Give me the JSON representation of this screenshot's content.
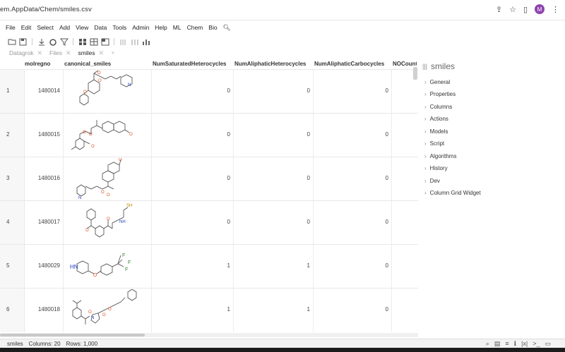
{
  "browser": {
    "url": "em.AppData/Chem/smiles.csv",
    "avatar_letter": "M"
  },
  "menu": [
    "File",
    "Edit",
    "Select",
    "Add",
    "View",
    "Data",
    "Tools",
    "Admin",
    "Help",
    "ML",
    "Chem",
    "Bio"
  ],
  "tabs": [
    {
      "label": "Datagrok",
      "active": false
    },
    {
      "label": "Files",
      "active": false
    },
    {
      "label": "smiles",
      "active": true
    }
  ],
  "grid": {
    "columns": [
      "molregno",
      "canonical_smiles",
      "NumSaturatedHeterocycles",
      "NumAliphaticHeterocycles",
      "NumAliphaticCarbocycles",
      "NOCount"
    ],
    "rows": [
      {
        "n": "1",
        "molregno": "1480014",
        "sat": "0",
        "ali": "0",
        "carbo": "0"
      },
      {
        "n": "2",
        "molregno": "1480015",
        "sat": "0",
        "ali": "0",
        "carbo": "0"
      },
      {
        "n": "3",
        "molregno": "1480016",
        "sat": "0",
        "ali": "0",
        "carbo": "0"
      },
      {
        "n": "4",
        "molregno": "1480017",
        "sat": "0",
        "ali": "0",
        "carbo": "0"
      },
      {
        "n": "5",
        "molregno": "1480029",
        "sat": "1",
        "ali": "1",
        "carbo": "0"
      },
      {
        "n": "6",
        "molregno": "1480018",
        "sat": "1",
        "ali": "1",
        "carbo": "0"
      }
    ]
  },
  "panel": {
    "title": "smiles",
    "items": [
      "General",
      "Properties",
      "Columns",
      "Actions",
      "Models",
      "Script",
      "Algorithms",
      "History",
      "Dev",
      "Column Grid Widget"
    ]
  },
  "status": {
    "table": "smiles",
    "columns": "Columns: 20",
    "rows": "Rows: 1,000"
  },
  "colors": {
    "accent": "#8e44ad",
    "oxygen": "#e05020",
    "nitrogen": "#2040c0"
  }
}
